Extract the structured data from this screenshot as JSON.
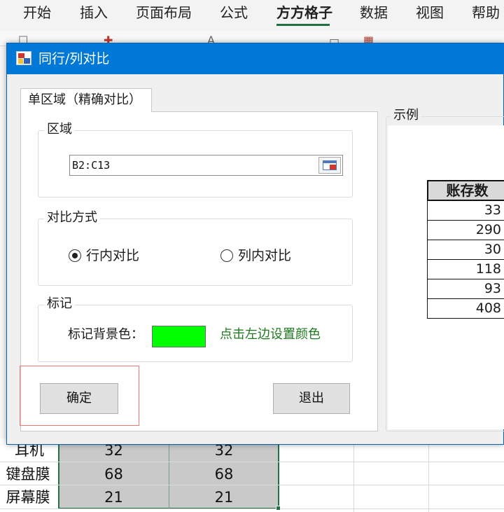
{
  "ribbon": {
    "tabs": [
      "开始",
      "插入",
      "页面布局",
      "公式",
      "方方格子",
      "数据",
      "视图",
      "帮助"
    ],
    "active_tab": "方方格子",
    "accent_color": "#1f6f43"
  },
  "sheet": {
    "rows": [
      {
        "name": "耳机",
        "col1": "32",
        "col2": "32"
      },
      {
        "name": "键盘膜",
        "col1": "68",
        "col2": "68"
      },
      {
        "name": "屏幕膜",
        "col1": "21",
        "col2": "21"
      }
    ],
    "selection_color": "#217346"
  },
  "dialog": {
    "title": "同行/列对比",
    "titlebar_color": "#0078d7",
    "tab_label": "单区域（精确对比）",
    "range_group": {
      "title": "区域",
      "value": "B2:C13",
      "picker_icon": "range-picker-icon"
    },
    "compare_group": {
      "title": "对比方式",
      "option_row": "行内对比",
      "option_col": "列内对比",
      "selected": "行内对比"
    },
    "mark_group": {
      "title": "标记",
      "label": "标记背景色：",
      "color": "#00ff00",
      "hint": "点击左边设置颜色"
    },
    "ok_button": "确定",
    "exit_button": "退出",
    "example": {
      "title": "示例",
      "header": "账存数",
      "values": [
        "33",
        "290",
        "30",
        "118",
        "93",
        "408"
      ],
      "highlight_color": "#f4e04d"
    }
  }
}
